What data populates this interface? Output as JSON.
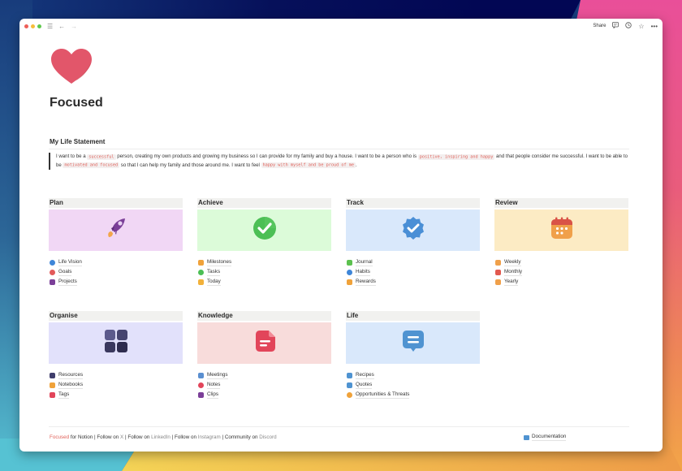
{
  "window": {
    "titlebar": {
      "share_label": "Share",
      "icons": [
        "sidebar-menu-icon",
        "back-arrow-icon",
        "forward-arrow-icon",
        "comment-icon",
        "history-clock-icon",
        "star-icon",
        "more-icon"
      ]
    }
  },
  "page": {
    "icon": "heart-icon",
    "title": "Focused",
    "statement": {
      "heading": "My Life Statement",
      "segments": [
        {
          "type": "text",
          "value": "I want to be a "
        },
        {
          "type": "code",
          "value": "successful"
        },
        {
          "type": "text",
          "value": " person, creating my own products and growing my business so I can provide for my family and buy a house. I want to be a person who is "
        },
        {
          "type": "code",
          "value": "positive, inspiring and happy"
        },
        {
          "type": "text",
          "value": " and that people consider me successful. I want to be able to be "
        },
        {
          "type": "code",
          "value": "motivated and focused"
        },
        {
          "type": "text",
          "value": " so that I can help my family and those around me. I want to feel "
        },
        {
          "type": "code",
          "value": "happy with myself and be proud of me"
        },
        {
          "type": "text",
          "value": "."
        }
      ]
    },
    "sections": [
      {
        "title": "Plan",
        "cover_icon": "rocket-icon",
        "cover_color": "#f1d7f5",
        "items": [
          {
            "label": "Life Vision",
            "icon": "compass-icon",
            "color": "#3f86d8"
          },
          {
            "label": "Goals",
            "icon": "target-icon",
            "color": "#e25a5a"
          },
          {
            "label": "Projects",
            "icon": "rocket-icon",
            "color": "#7b3f98"
          }
        ]
      },
      {
        "title": "Achieve",
        "cover_icon": "check-circle-icon",
        "cover_color": "#dcfbd9",
        "items": [
          {
            "label": "Milestones",
            "icon": "crown-icon",
            "color": "#f0a23a"
          },
          {
            "label": "Tasks",
            "icon": "check-circle-icon",
            "color": "#4cbf55"
          },
          {
            "label": "Today",
            "icon": "star-icon",
            "color": "#f2b13a"
          }
        ]
      },
      {
        "title": "Track",
        "cover_icon": "verified-badge-icon",
        "cover_color": "#d9e8fb",
        "items": [
          {
            "label": "Journal",
            "icon": "chat-icon",
            "color": "#5cc14f"
          },
          {
            "label": "Habits",
            "icon": "verified-badge-icon",
            "color": "#3f86d8"
          },
          {
            "label": "Rewards",
            "icon": "trophy-icon",
            "color": "#f0a23a"
          }
        ]
      },
      {
        "title": "Review",
        "cover_icon": "calendar-icon",
        "cover_color": "#fcebc4",
        "items": [
          {
            "label": "Weekly",
            "icon": "calendar-icon",
            "color": "#f0a04a"
          },
          {
            "label": "Monthly",
            "icon": "calendar-icon",
            "color": "#e2594f"
          },
          {
            "label": "Yearly",
            "icon": "calendar-icon",
            "color": "#f0a04a"
          }
        ]
      },
      {
        "title": "Organise",
        "cover_icon": "grid-icon",
        "cover_color": "#e2e1fb",
        "items": [
          {
            "label": "Resources",
            "icon": "grid-icon",
            "color": "#3f3d6b"
          },
          {
            "label": "Notebooks",
            "icon": "folder-icon",
            "color": "#f0a23a"
          },
          {
            "label": "Tags",
            "icon": "tag-icon",
            "color": "#e2455a"
          }
        ]
      },
      {
        "title": "Knowledge",
        "cover_icon": "document-icon",
        "cover_color": "#f8dcdb",
        "items": [
          {
            "label": "Meetings",
            "icon": "meeting-notes-icon",
            "color": "#5a8fd0"
          },
          {
            "label": "Notes",
            "icon": "note-icon",
            "color": "#e2455a"
          },
          {
            "label": "Clips",
            "icon": "bookmark-icon",
            "color": "#7b3f98"
          }
        ]
      },
      {
        "title": "Life",
        "cover_icon": "message-bubble-icon",
        "cover_color": "#d9e8fb",
        "items": [
          {
            "label": "Recipes",
            "icon": "recipe-book-icon",
            "color": "#4f93d1"
          },
          {
            "label": "Quotes",
            "icon": "message-bubble-icon",
            "color": "#4f93d1"
          },
          {
            "label": "Opportunities & Threats",
            "icon": "question-icon",
            "color": "#f0a23a"
          }
        ]
      }
    ],
    "footer": {
      "brand": "Focused",
      "for_text": " for Notion | Follow on ",
      "x_link": "X",
      "sep1": " | Follow on ",
      "linkedin_link": "LinkedIn",
      "sep2": " | Follow on ",
      "instagram_link": "Instagram",
      "sep3": " | Community on ",
      "discord_link": "Discord",
      "documentation_link": "Documentation"
    }
  }
}
